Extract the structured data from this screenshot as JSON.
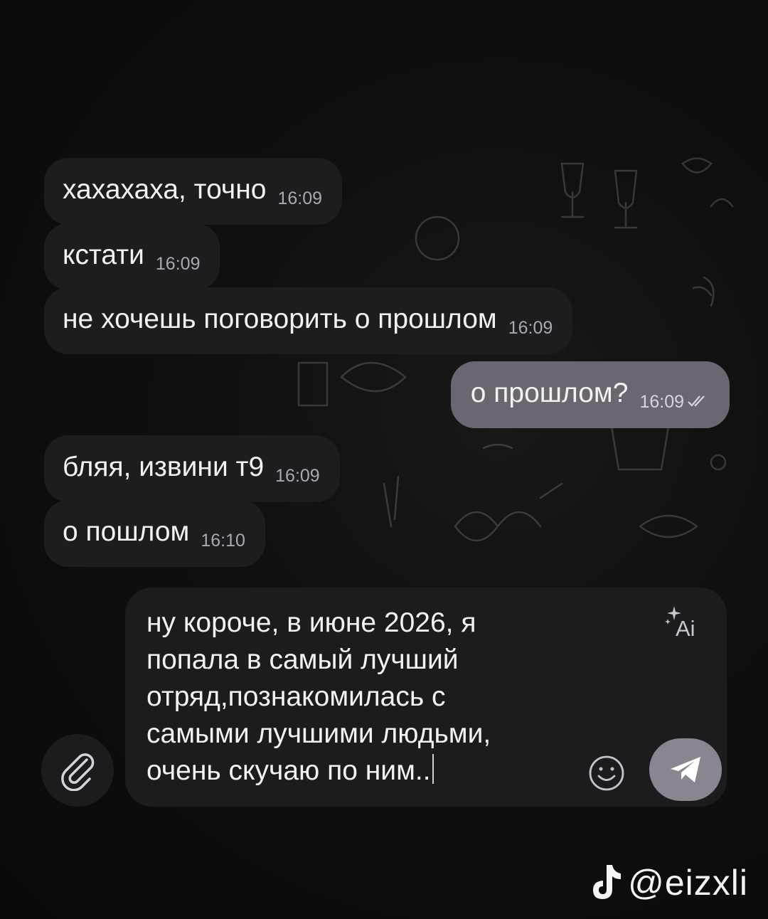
{
  "messages": [
    {
      "text": "хахахаха, точно",
      "time": "16:09",
      "direction": "in"
    },
    {
      "text": "кстати",
      "time": "16:09",
      "direction": "in"
    },
    {
      "text": "не хочешь поговорить о прошлом",
      "time": "16:09",
      "direction": "in"
    },
    {
      "text": "о прошлом?",
      "time": "16:09",
      "direction": "out",
      "status": "read"
    },
    {
      "text": "бляя, извини т9",
      "time": "16:09",
      "direction": "in"
    },
    {
      "text": "о пошлом",
      "time": "16:10",
      "direction": "in"
    }
  ],
  "composer": {
    "text": "ну короче, в июне 2026, я\nпопала в самый лучший\nотряд,познакомилась с\nсамыми лучшими людьми,\nочень скучаю по ним..",
    "ai_label": "Ai",
    "attach_icon": "paperclip-icon",
    "emoji_icon": "smiley-icon",
    "send_icon": "paper-plane-icon"
  },
  "watermark": {
    "platform_icon": "tiktok-icon",
    "handle": "@eizxli"
  },
  "colors": {
    "background": "#0c0c0d",
    "incoming_bubble": "#1d1d1f",
    "outgoing_bubble": "#6c6670",
    "send_button": "#8b8590"
  }
}
